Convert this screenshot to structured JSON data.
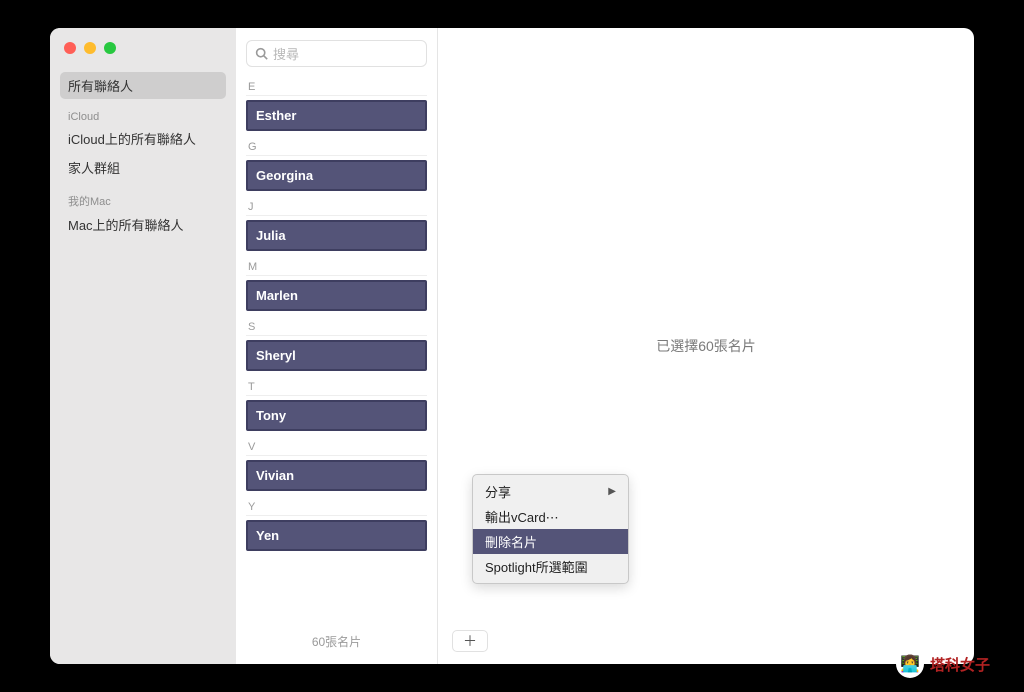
{
  "sidebar": {
    "all": "所有聯絡人",
    "icloud_header": "iCloud",
    "icloud_all": "iCloud上的所有聯絡人",
    "family": "家人群組",
    "mymac_header": "我的Mac",
    "mac_all": "Mac上的所有聯絡人"
  },
  "search": {
    "placeholder": "搜尋"
  },
  "sections": {
    "e": "E",
    "g": "G",
    "j": "J",
    "m": "M",
    "s": "S",
    "t": "T",
    "v": "V",
    "y": "Y"
  },
  "contacts": {
    "e": "Esther",
    "g": "Georgina",
    "j": "Julia",
    "m": "Marlen",
    "s": "Sheryl",
    "t": "Tony",
    "v": "Vivian",
    "y": "Yen"
  },
  "footer": "60張名片",
  "detail": "已選擇60張名片",
  "context_menu": {
    "share": "分享",
    "export": "輸出vCard⋯",
    "delete": "刪除名片",
    "spotlight": "Spotlight所選範圍"
  },
  "add_button": "＋",
  "watermark": "塔科女子"
}
